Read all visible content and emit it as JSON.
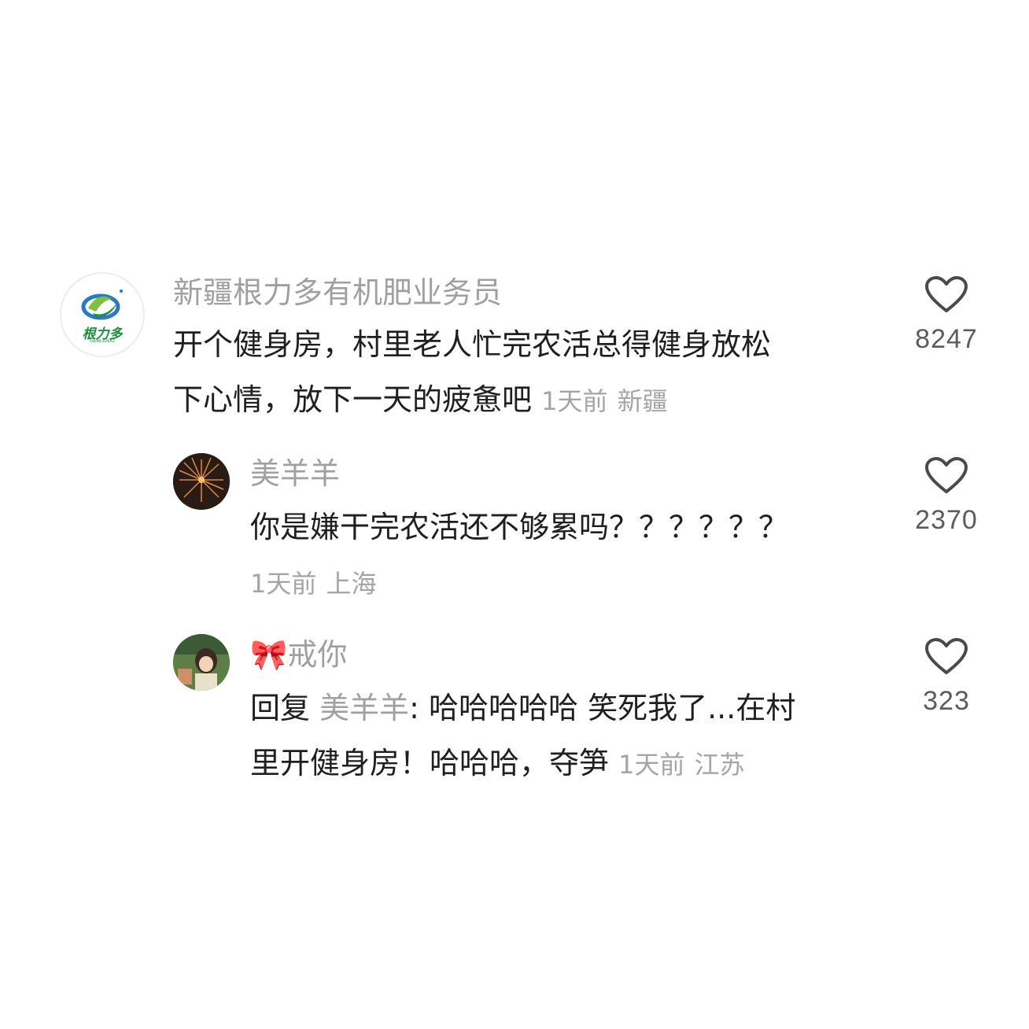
{
  "comments": [
    {
      "username": "新疆根力多有机肥业务员",
      "line1": "开个健身房，村里老人忙完农活总得健身放松",
      "line2": "下心情，放下一天的疲惫吧",
      "time": "1天前",
      "location": "新疆",
      "likes": "8247",
      "avatar_logo_text": "根力多",
      "avatar_logo_sub": "GENLIDUO"
    },
    {
      "username": "美羊羊",
      "text": "你是嫌干完农活还不够累吗？？？？？？",
      "time": "1天前",
      "location": "上海",
      "likes": "2370"
    },
    {
      "username_prefix": "🎀",
      "username": "戒你",
      "reply_label": "回复",
      "reply_target": "美羊羊",
      "line1": ": 哈哈哈哈哈  笑死我了...在村",
      "line2": "里开健身房！哈哈哈，夺笋",
      "time": "1天前",
      "location": "江苏",
      "likes": "323"
    }
  ],
  "colors": {
    "username": "#a0a0a0",
    "text": "#1f1f1f",
    "meta": "#a5a5a5",
    "like_icon": "#4a4a4a"
  }
}
